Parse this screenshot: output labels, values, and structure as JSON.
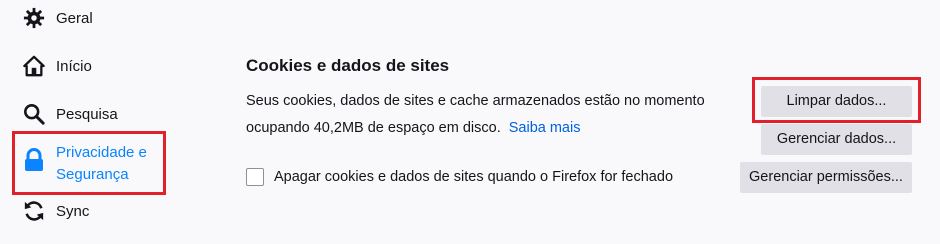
{
  "sidebar": {
    "items": [
      {
        "label": "Geral",
        "icon": "gear-icon"
      },
      {
        "label": "Início",
        "icon": "home-icon"
      },
      {
        "label": "Pesquisa",
        "icon": "search-icon"
      },
      {
        "label": "Privacidade e Segurança",
        "icon": "lock-icon",
        "selected": true
      },
      {
        "label": "Sync",
        "icon": "sync-icon"
      }
    ]
  },
  "main": {
    "section_title": "Cookies e dados de sites",
    "description": "Seus cookies, dados de sites e cache armazenados estão no momento ocupando 40,2MB de espaço em disco.",
    "learn_more": "Saiba mais",
    "checkbox_label": "Apagar cookies e dados de sites quando o Firefox for fechado",
    "checkbox_checked": false,
    "buttons": {
      "clear_data": "Limpar dados...",
      "manage_data": "Gerenciar dados...",
      "manage_permissions": "Gerenciar permissões..."
    }
  },
  "colors": {
    "accent": "#0a84ff",
    "highlight": "#e0202b",
    "link": "#0061e0"
  }
}
